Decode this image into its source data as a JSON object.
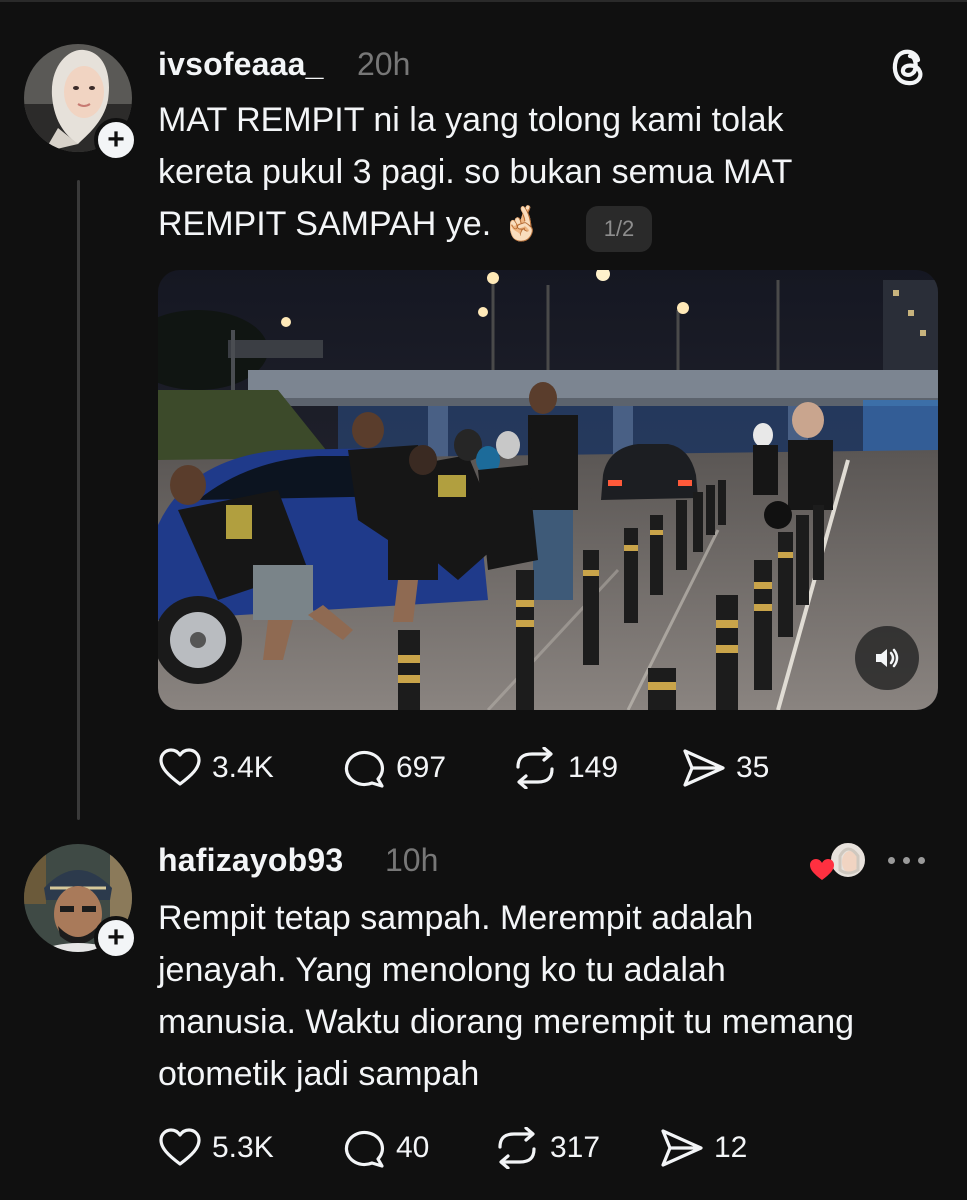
{
  "post": {
    "username": "ivsofeaaa_",
    "time": "20h",
    "text": "MAT REMPIT ni la yang tolong kami tolak\nkereta pukul 3 pagi. so bukan semua MAT\nREMPIT SAMPAH ye. 🤞🏻",
    "page_indicator": "1/2",
    "actions": {
      "likes": "3.4K",
      "comments": "697",
      "reposts": "149",
      "shares": "35"
    }
  },
  "reply": {
    "username": "hafizayob93",
    "time": "10h",
    "text": "Rempit tetap sampah. Merempit adalah\njenayah. Yang menolong ko tu adalah\nmanusia. Waktu diorang merempit tu memang\notometik jadi sampah",
    "actions": {
      "likes": "5.3K",
      "comments": "40",
      "reposts": "317",
      "shares": "12"
    }
  },
  "icons": {
    "app_logo": "threads-logo-icon",
    "follow": "plus-icon",
    "like": "heart-icon",
    "comment": "comment-bubble-icon",
    "repost": "repost-icon",
    "share": "send-icon",
    "sound": "speaker-icon",
    "more": "more-dots-icon"
  },
  "colors": {
    "background": "#101010",
    "text": "#f3f5f7",
    "muted": "#777777",
    "heart": "#ff3040"
  }
}
